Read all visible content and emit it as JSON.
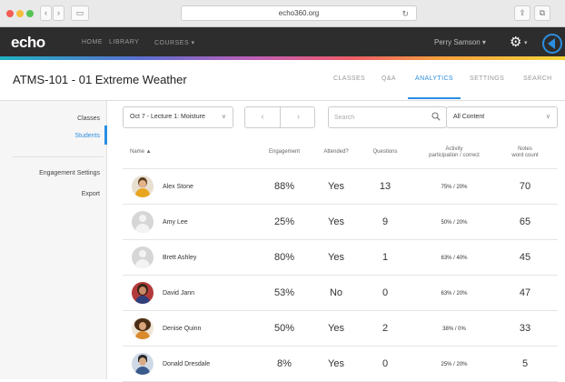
{
  "browser": {
    "url": "echo360.org",
    "back": "‹",
    "forward": "›",
    "sidebar_toggle": "▭",
    "share": "⇪"
  },
  "topnav": {
    "logo": "echo",
    "links": [
      "HOME",
      "LIBRARY",
      "COURSES ▾"
    ],
    "user": "Perry Samson ▾"
  },
  "course": {
    "title": "ATMS-101 - 01 Extreme Weather",
    "tabs": [
      "CLASSES",
      "Q&A",
      "ANALYTICS",
      "SETTINGS",
      "SEARCH"
    ],
    "active_tab": "ANALYTICS"
  },
  "sidebar": {
    "items": [
      "Classes",
      "Students",
      "Engagement Settings",
      "Export"
    ],
    "active": "Students"
  },
  "filters": {
    "lecture": "Oct 7 - Lecture 1: Moisture",
    "search_placeholder": "Search",
    "content": "All Content"
  },
  "table": {
    "headers": {
      "name": "Name ▲",
      "engagement": "Engagement",
      "attended": "Attended?",
      "questions": "Questions",
      "activity_l1": "Activity",
      "activity_l2": "participation / correct",
      "notes_l1": "Notes",
      "notes_l2": "word count"
    },
    "rows": [
      {
        "name": "Alex Stone",
        "engagement": "88%",
        "attended": "Yes",
        "questions": "13",
        "activity": "75% / 20%",
        "notes": "70"
      },
      {
        "name": "Amy Lee",
        "engagement": "25%",
        "attended": "Yes",
        "questions": "9",
        "activity": "50% / 20%",
        "notes": "65"
      },
      {
        "name": "Brett Ashley",
        "engagement": "80%",
        "attended": "Yes",
        "questions": "1",
        "activity": "63% / 40%",
        "notes": "45"
      },
      {
        "name": "David Jann",
        "engagement": "53%",
        "attended": "No",
        "questions": "0",
        "activity": "63% / 20%",
        "notes": "47"
      },
      {
        "name": "Denise Quinn",
        "engagement": "50%",
        "attended": "Yes",
        "questions": "2",
        "activity": "38% / 0%",
        "notes": "33"
      },
      {
        "name": "Donald Dresdale",
        "engagement": "8%",
        "attended": "Yes",
        "questions": "0",
        "activity": "25% / 20%",
        "notes": "5"
      }
    ]
  },
  "colors": {
    "accent": "#2b8ee0",
    "nav_bg": "#2d2d2d"
  }
}
